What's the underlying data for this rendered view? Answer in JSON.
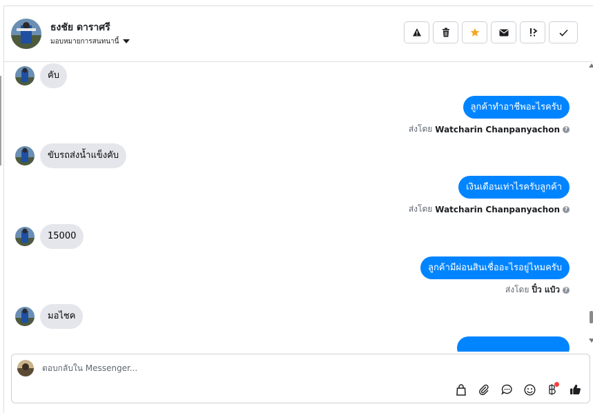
{
  "header": {
    "contact_name": "ธงชัย ดาราศรี",
    "assign_label": "มอบหมายการสนทนานี้"
  },
  "actions": [
    {
      "name": "spam",
      "icon": "warning-icon"
    },
    {
      "name": "delete",
      "icon": "trash-icon"
    },
    {
      "name": "star",
      "icon": "star-icon",
      "color": "#f5a623"
    },
    {
      "name": "mark-unread",
      "icon": "envelope-icon"
    },
    {
      "name": "follow-up",
      "icon": "follow-up-icon"
    },
    {
      "name": "done",
      "icon": "check-icon"
    }
  ],
  "messages": [
    {
      "dir": "in",
      "text": "คับ"
    },
    {
      "dir": "out",
      "text": "ลูกค้าทำอาชีพอะไรครับ",
      "sent_by_label": "ส่งโดย",
      "sender": "Watcharin Chanpanyachon"
    },
    {
      "dir": "in",
      "text": "ขับรถส่งน้ำแข็งคับ"
    },
    {
      "dir": "out",
      "text": "เงินเดือนเท่าไรครับลูกค้า",
      "sent_by_label": "ส่งโดย",
      "sender": "Watcharin Chanpanyachon"
    },
    {
      "dir": "in",
      "text": "15000"
    },
    {
      "dir": "out",
      "text": "ลูกค้ามีผ่อนสินเชื่ออะไรอยู่ไหมครับ",
      "sent_by_label": "ส่งโดย",
      "sender": "ปิ๋ว แป๋ว"
    },
    {
      "dir": "in",
      "text": "มอไชค"
    }
  ],
  "composer": {
    "placeholder": "ตอบกลับใน Messenger..."
  },
  "tools": [
    "bag-icon",
    "paperclip-icon",
    "saved-reply-icon",
    "emoji-icon",
    "baht-icon",
    "thumbs-up-icon"
  ],
  "colors": {
    "outgoing_bubble": "#0084ff",
    "incoming_bubble": "#e4e6eb",
    "notification_dot": "#fa3e3e"
  }
}
